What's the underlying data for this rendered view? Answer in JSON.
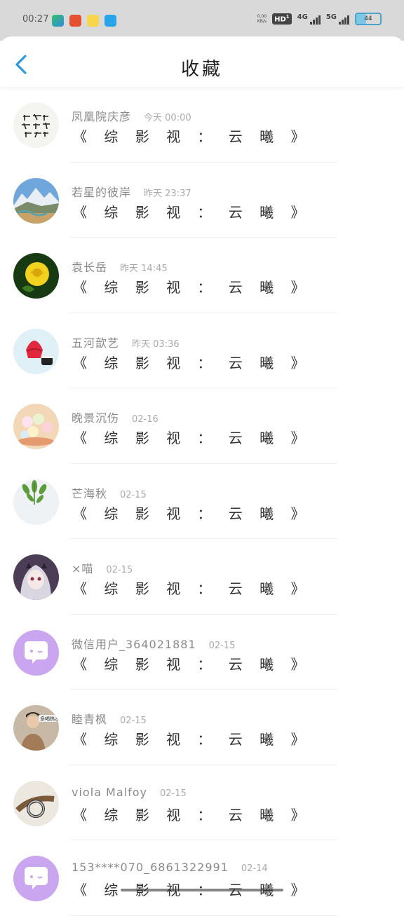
{
  "status_bar": {
    "time": "00:27",
    "net_speed_top": "0.00",
    "net_speed_bottom": "KB/s",
    "hd_label": "HD",
    "hd_sub": "1",
    "signal_1": "4G",
    "signal_2": "5G",
    "battery": "44"
  },
  "header": {
    "title": "收藏",
    "accent_color": "#2b9be0"
  },
  "items": [
    {
      "name": "凤凰院庆彦",
      "date": "今天 00:00",
      "message": "《 综 影 视 ： 云 曦 》",
      "avatar": "calligraphy"
    },
    {
      "name": "若星的彼岸",
      "date": "昨天 23:37",
      "message": "《 综 影 视 ： 云 曦 》",
      "avatar": "landscape"
    },
    {
      "name": "袁长岳",
      "date": "昨天 14:45",
      "message": "《 综 影 视 ： 云 曦 》",
      "avatar": "yellow-rose"
    },
    {
      "name": "五河歆艺",
      "date": "昨天 03:36",
      "message": "《 综 影 视 ： 云 曦 》",
      "avatar": "ice-cream"
    },
    {
      "name": "晚景沉伤",
      "date": "02-16",
      "message": "《 综 影 视 ： 云 曦 》",
      "avatar": "dessert"
    },
    {
      "name": "芒海秋",
      "date": "02-15",
      "message": "《 综 影 视 ： 云 曦 》",
      "avatar": "plant"
    },
    {
      "name": "×喵",
      "date": "02-15",
      "message": "《 综 影 视 ： 云 曦 》",
      "avatar": "anime"
    },
    {
      "name": "微信用户_364021881",
      "date": "02-15",
      "message": "《 综 影 视 ： 云 曦 》",
      "avatar": "default-chat"
    },
    {
      "name": "睦青枫",
      "date": "02-15",
      "message": "《 综 影 视 ： 云 曦 》",
      "avatar": "person"
    },
    {
      "name": "viola Malfoy",
      "date": "02-15",
      "message": "《 综 影 视 ： 云 曦 》",
      "avatar": "ring"
    },
    {
      "name": "153****070_6861322991",
      "date": "02-14",
      "message": "《 综 影 视 ： 云 曦 》",
      "avatar": "default-chat"
    }
  ]
}
